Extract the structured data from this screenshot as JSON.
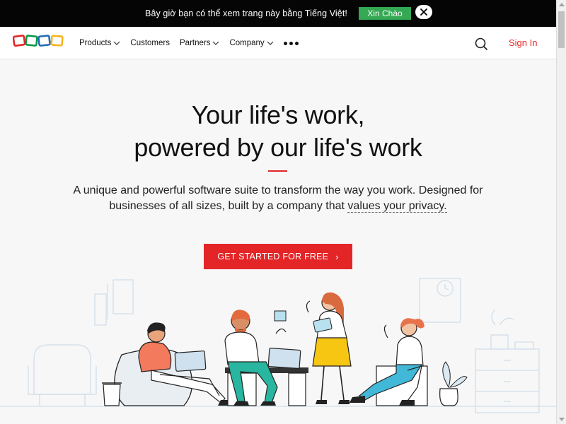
{
  "banner": {
    "text": "Bây giờ bạn có thể xem trang này bằng Tiếng Việt!",
    "button_label": "Xin Chào",
    "close_glyph": "✕"
  },
  "header": {
    "logo_text": "ZOHO",
    "nav": [
      {
        "label": "Products",
        "has_dropdown": true
      },
      {
        "label": "Customers",
        "has_dropdown": false
      },
      {
        "label": "Partners",
        "has_dropdown": true
      },
      {
        "label": "Company",
        "has_dropdown": true
      }
    ],
    "more_icon": "ellipsis-icon",
    "search_icon": "search-icon",
    "signin_label": "Sign In"
  },
  "hero": {
    "title_line1": "Your life's work,",
    "title_line2": "powered by our life's work",
    "subtitle_part1": "A unique and powerful software suite to transform the way you work. Designed for businesses of all sizes, built by a company that ",
    "subtitle_link": "values your privacy.",
    "cta_label": "GET STARTED FOR FREE",
    "cta_arrow": "›"
  },
  "colors": {
    "accent_red": "#e42527",
    "banner_bg": "#050505",
    "banner_button": "#34a853",
    "logo_red": "#e42527",
    "logo_green": "#089949",
    "logo_blue": "#226db4",
    "logo_yellow": "#f9b21d"
  }
}
